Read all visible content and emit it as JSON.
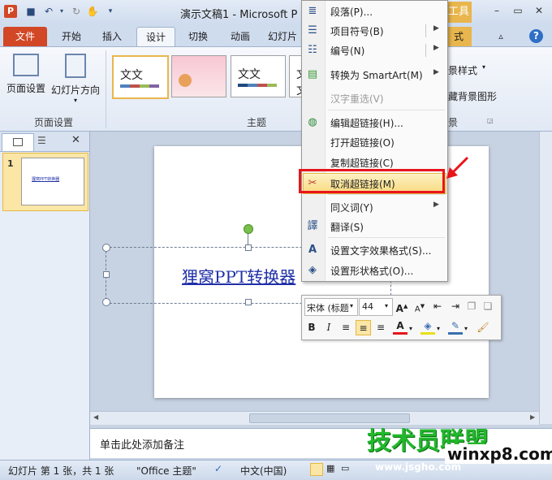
{
  "window": {
    "title": "演示文稿1 - Microsoft P",
    "app_icon": "P",
    "contextual_tab": "工具"
  },
  "tabs": {
    "file": "文件",
    "home": "开始",
    "insert": "插入",
    "design": "设计",
    "transitions": "切换",
    "animations": "动画",
    "slideshow": "幻灯片",
    "format_partial": "式"
  },
  "ribbon": {
    "page_setup": "页面设置",
    "slide_orientation": "幻灯片方向",
    "group_page_setup": "页面设置",
    "group_themes": "主题",
    "theme_label": "文文",
    "bg_styles": "景样式",
    "hide_bg": "藏背景图形",
    "group_bg": "景"
  },
  "slides_pane": {
    "slide_number": "1",
    "thumb_text": "狸窝PPT转换器"
  },
  "slide": {
    "hyperlink_text": "狸窝PPT转换器"
  },
  "context_menu": {
    "paragraph": "段落(P)...",
    "bullets": "项目符号(B)",
    "numbering": "编号(N)",
    "smartart": "转换为 SmartArt(M)",
    "hanzi": "汉字重选(V)",
    "edit_link": "编辑超链接(H)...",
    "open_link": "打开超链接(O)",
    "copy_link": "复制超链接(C)",
    "remove_link": "取消超链接(M)",
    "synonyms": "同义词(Y)",
    "translate": "翻译(S)",
    "text_effects": "设置文字效果格式(S)...",
    "shape_format": "设置形状格式(O)..."
  },
  "mini_toolbar": {
    "font": "宋体 (标题",
    "size": "44"
  },
  "notes": {
    "placeholder": "单击此处添加备注"
  },
  "status": {
    "slide_info": "幻灯片 第 1 张，共 1 张",
    "theme": "\"Office 主题\"",
    "language": "中文(中国)"
  },
  "watermark": {
    "line1": "技术员联盟",
    "line2": "www.jsgho.com",
    "line3": "winxp8.com"
  },
  "colors": {
    "accent_file_tab": "#d24726",
    "highlight_box": "#e8141b",
    "hyperlink": "#1f2fa8"
  }
}
